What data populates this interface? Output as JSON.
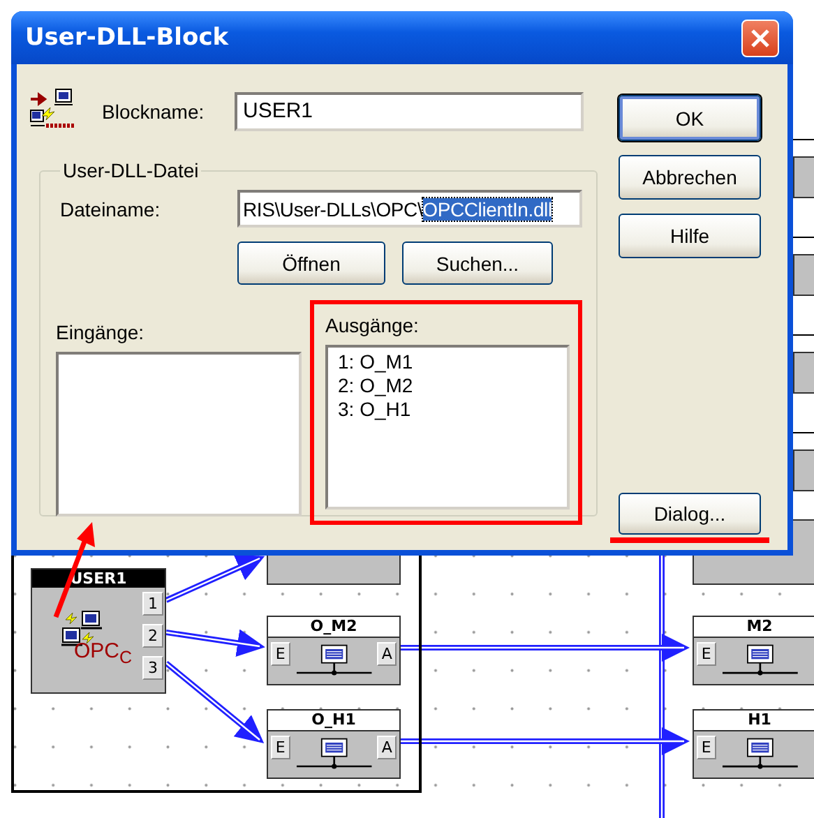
{
  "dialog": {
    "title": "User-DLL-Block",
    "blockname_label": "Blockname:",
    "blockname_value": "USER1",
    "group": {
      "title": "User-DLL-Datei",
      "file_label": "Dateiname:",
      "file_value": "RIS\\User-DLLs\\OPC\\",
      "file_selected": "OPCClientIn.dll",
      "buttons": [
        "Öffnen",
        "Suchen..."
      ]
    },
    "inputs": {
      "label": "Eingänge:"
    },
    "outputs": {
      "label": "Ausgänge:",
      "items": [
        "1: O_M1",
        "2: O_M2",
        "3: O_H1"
      ]
    },
    "buttons": [
      {
        "label": "OK",
        "default": true
      },
      {
        "label": "Abbrechen",
        "default": false
      },
      {
        "label": "Hilfe",
        "default": false
      }
    ],
    "dialog_button": "Dialog..."
  },
  "canvas": {
    "block": {
      "title": "USER1",
      "ports": [
        "1",
        "2",
        "3"
      ],
      "caption": "OPC$_{C}$"
    },
    "nodes": [
      {
        "title": "O_M2",
        "in": "E",
        "out": "A"
      },
      {
        "title": "O_H1",
        "in": "E",
        "out": "A"
      },
      {
        "title": "M2",
        "in": "E"
      },
      {
        "title": "H1",
        "in": "E"
      }
    ]
  }
}
